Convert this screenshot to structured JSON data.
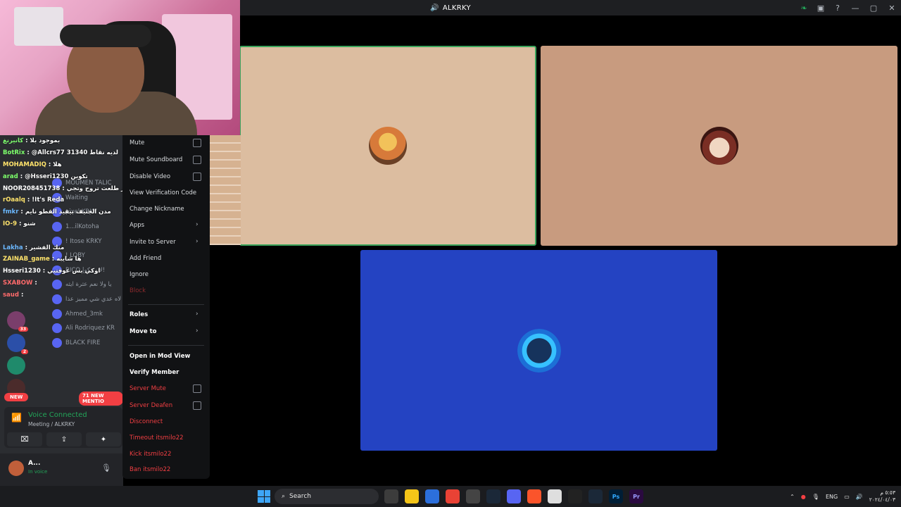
{
  "window": {
    "title": "ALKRKY",
    "icon": "speaker-icon"
  },
  "titlebar_icons": [
    "nitro-leaf-icon",
    "screen-share-icon",
    "help-icon",
    "minimize-icon",
    "maximize-icon",
    "close-icon"
  ],
  "titlebar_glyphs": {
    "minimize": "—",
    "maximize": "▢",
    "close": "✕",
    "help": "?"
  },
  "chat": [
    {
      "name": "كانيرنغ",
      "text": "بموجود بلا",
      "color": "g"
    },
    {
      "name": "BotRix",
      "text": "@Allcrs77 لديه نقاط 31340",
      "color": "g"
    },
    {
      "name": "MOHAMADIQ",
      "text": "هلا",
      "color": "y"
    },
    {
      "name": "arad",
      "text": "@Hsseri1230 تكوين",
      "color": "g"
    },
    {
      "name": "NOOR208451738",
      "text": "يقولها بس بشير طلعت تروح وتجي",
      "color": "w"
    },
    {
      "name": "rOaalq",
      "text": "!It's Reda",
      "color": "y"
    },
    {
      "name": "fmkr",
      "text": "مدن الجنيف بيقيد القطو نايم",
      "color": "b"
    },
    {
      "name": "IO-9",
      "text": "شنو",
      "color": "y"
    },
    {
      "name": "",
      "text": "",
      "color": "w"
    },
    {
      "name": "Lakha",
      "text": "منك الفشير",
      "color": "b"
    },
    {
      "name": "ZAINAB_game",
      "text": "ها شايبه",
      "color": "y"
    },
    {
      "name": "Hsseri1230",
      "text": "اوكي بس عوقتيي",
      "color": "w"
    },
    {
      "name": "SXABOW",
      "text": "",
      "color": "r"
    },
    {
      "name": "saud",
      "text": "",
      "color": "r"
    }
  ],
  "userlist": [
    {
      "name": "MOUMEN TALIC"
    },
    {
      "name": "Waiting"
    },
    {
      "name": "pixel  KRKY"
    },
    {
      "name": "1...ilKotoha"
    },
    {
      "name": "! Itose  KRKY"
    },
    {
      "name": "! LOBY"
    },
    {
      "name": "RICO |لا زحكو!"
    },
    {
      "name": "يا ولا نعم عثرة ايثه"
    },
    {
      "name": "لاه عدي شي مميز عذا"
    },
    {
      "name": "Ahmed_3mk"
    },
    {
      "name": "Ali Rodriquez  KR"
    },
    {
      "name": "BLACK FIRE"
    }
  ],
  "servers": [
    {
      "badge": "33",
      "color": "#7a3e6b"
    },
    {
      "badge": "2",
      "color": "#2b4fa8"
    },
    {
      "badge": "",
      "color": "#1f8a6b"
    },
    {
      "badge": "",
      "color": "#4b2b2b"
    }
  ],
  "new_pill": "NEW",
  "mentions_pill": "71 NEW MENTIO",
  "voice": {
    "status": "Voice Connected",
    "channel": "Meeting / ALKRKY",
    "buttons": [
      "video-off-icon",
      "screen-share-icon",
      "activities-icon"
    ]
  },
  "user": {
    "name": "A...",
    "status": "In voice"
  },
  "context_menu": {
    "items": [
      {
        "label": "Mute",
        "style": "normal",
        "control": "checkbox"
      },
      {
        "label": "Mute Soundboard",
        "style": "normal",
        "control": "checkbox"
      },
      {
        "label": "Disable Video",
        "style": "normal",
        "control": "checkbox"
      },
      {
        "label": "View Verification Code",
        "style": "normal",
        "control": ""
      },
      {
        "label": "Change Nickname",
        "style": "normal",
        "control": ""
      },
      {
        "label": "Apps",
        "style": "normal",
        "control": "arrow"
      },
      {
        "label": "Invite to Server",
        "style": "normal",
        "control": "arrow"
      },
      {
        "label": "Add Friend",
        "style": "normal",
        "control": ""
      },
      {
        "label": "Ignore",
        "style": "normal",
        "control": ""
      },
      {
        "label": "Block",
        "style": "disabled",
        "control": ""
      },
      {
        "label": "Roles",
        "style": "bold",
        "control": "arrow"
      },
      {
        "label": "Move to",
        "style": "bold",
        "control": "arrow"
      },
      {
        "label": "Open in Mod View",
        "style": "bold",
        "control": ""
      },
      {
        "label": "Verify Member",
        "style": "bold",
        "control": ""
      },
      {
        "label": "Server Mute",
        "style": "red",
        "control": "checkbox"
      },
      {
        "label": "Server Deafen",
        "style": "red",
        "control": "checkbox"
      },
      {
        "label": "Disconnect",
        "style": "red",
        "control": ""
      },
      {
        "label": "Timeout itsmilo22",
        "style": "red",
        "control": ""
      },
      {
        "label": "Kick itsmilo22",
        "style": "red",
        "control": ""
      },
      {
        "label": "Ban itsmilo22",
        "style": "red",
        "control": ""
      }
    ]
  },
  "tiles": [
    {
      "name": "naruto-avatar",
      "speaking": true,
      "color": "#dcbda0"
    },
    {
      "name": "man-avatar",
      "speaking": false,
      "color": "#c89b7f"
    },
    {
      "name": "anime-avatar",
      "speaking": false,
      "color": "#2443c2"
    }
  ],
  "taskbar": {
    "search_label": "Search",
    "apps": [
      "task-view-icon",
      "file-explorer-icon",
      "store-icon",
      "chrome-icon",
      "github-icon",
      "steam-icon",
      "discord-icon",
      "brave-icon",
      "notes-icon",
      "capcut-icon",
      "steam2-icon",
      "photoshop-icon",
      "premiere-icon"
    ],
    "app_labels": {
      "photoshop": "Ps",
      "premiere": "Pr"
    },
    "language": "ENG",
    "time": "٥:٥٣ م",
    "date": "٢٠٢٤/٠٤/٠٣"
  },
  "colors": {
    "accent": "#5865f2",
    "speaking": "#3ba55c",
    "danger": "#f23f43",
    "voice_green": "#23a559"
  }
}
